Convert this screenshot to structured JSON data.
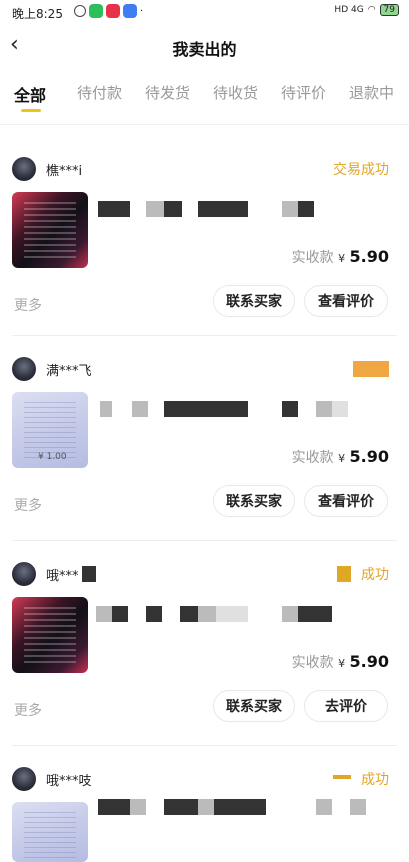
{
  "status_bar": {
    "time": "晚上8:25",
    "network": "HD 4G",
    "battery": "79"
  },
  "nav": {
    "title": "我卖出的"
  },
  "tabs": [
    {
      "label": "全部",
      "active": true
    },
    {
      "label": "待付款",
      "active": false
    },
    {
      "label": "待发货",
      "active": false
    },
    {
      "label": "待收货",
      "active": false
    },
    {
      "label": "待评价",
      "active": false
    },
    {
      "label": "退款中",
      "active": false
    }
  ],
  "orders": [
    {
      "buyer": "樵***i",
      "status": "交易成功",
      "paid_label": "实收款",
      "currency": "¥",
      "amount": "5.90",
      "more": "更多",
      "contact_button": "联系买家",
      "review_button": "查看评价"
    },
    {
      "buyer": "满***飞",
      "status": "",
      "paid_label": "实收款",
      "currency": "¥",
      "amount": "5.90",
      "more": "更多",
      "contact_button": "联系买家",
      "review_button": "查看评价"
    },
    {
      "buyer": "哦***",
      "status": "成功",
      "paid_label": "实收款",
      "currency": "¥",
      "amount": "5.90",
      "more": "更多",
      "contact_button": "联系买家",
      "review_button": "去评价"
    },
    {
      "buyer": "哦***吱",
      "status": "成功"
    }
  ],
  "thumb_text": "¥ 1.00",
  "accent_color": "#e0a626",
  "tab_indicator_color": "#f0c419"
}
